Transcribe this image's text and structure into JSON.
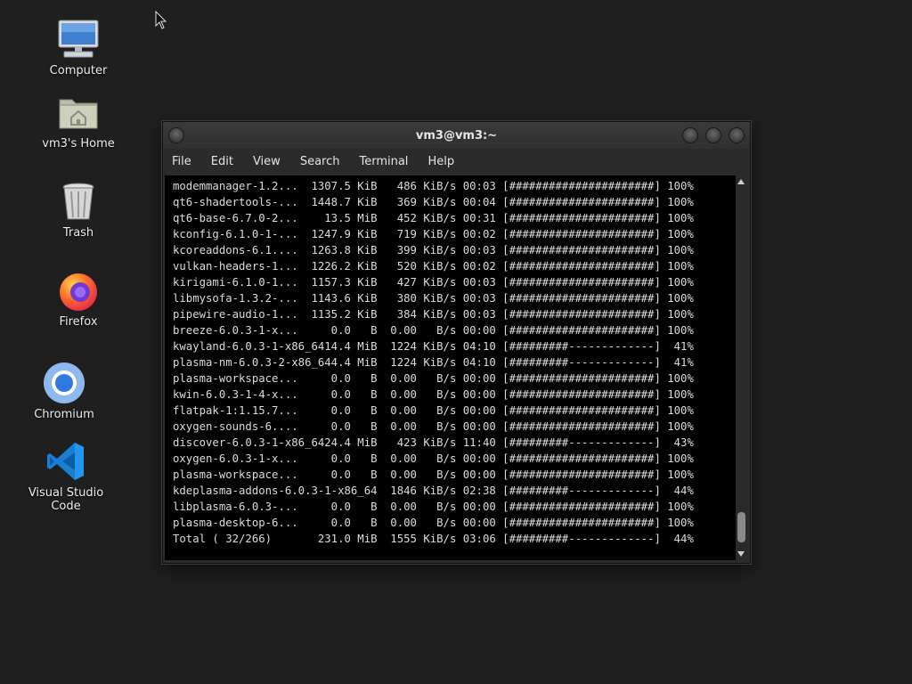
{
  "desktop": {
    "icons": [
      {
        "label": "Computer",
        "icon": "computer-icon"
      },
      {
        "label": "vm3's Home",
        "icon": "home-folder-icon"
      },
      {
        "label": "Trash",
        "icon": "trash-icon"
      },
      {
        "label": "Firefox",
        "icon": "firefox-icon"
      },
      {
        "label": "Chromium",
        "icon": "chromium-icon"
      },
      {
        "label": "Visual Studio Code",
        "icon": "vscode-icon"
      }
    ]
  },
  "window": {
    "title": "vm3@vm3:~",
    "menu": [
      "File",
      "Edit",
      "View",
      "Search",
      "Terminal",
      "Help"
    ]
  },
  "terminal": {
    "lines": [
      "modemmanager-1.2...  1307.5 KiB   486 KiB/s 00:03 [######################] 100%",
      "qt6-shadertools-...  1448.7 KiB   369 KiB/s 00:04 [######################] 100%",
      "qt6-base-6.7.0-2...    13.5 MiB   452 KiB/s 00:31 [######################] 100%",
      "kconfig-6.1.0-1-...  1247.9 KiB   719 KiB/s 00:02 [######################] 100%",
      "kcoreaddons-6.1....  1263.8 KiB   399 KiB/s 00:03 [######################] 100%",
      "vulkan-headers-1...  1226.2 KiB   520 KiB/s 00:02 [######################] 100%",
      "kirigami-6.1.0-1...  1157.3 KiB   427 KiB/s 00:03 [######################] 100%",
      "libmysofa-1.3.2-...  1143.6 KiB   380 KiB/s 00:03 [######################] 100%",
      "pipewire-audio-1...  1135.2 KiB   384 KiB/s 00:03 [######################] 100%",
      "breeze-6.0.3-1-x...     0.0   B  0.00   B/s 00:00 [######################] 100%",
      "kwayland-6.0.3-1-x86_6414.4 MiB  1224 KiB/s 04:10 [#########-------------]  41%",
      "plasma-nm-6.0.3-2-x86_644.4 MiB  1224 KiB/s 04:10 [#########-------------]  41%",
      "plasma-workspace...     0.0   B  0.00   B/s 00:00 [######################] 100%",
      "kwin-6.0.3-1-4-x...     0.0   B  0.00   B/s 00:00 [######################] 100%",
      "flatpak-1:1.15.7...     0.0   B  0.00   B/s 00:00 [######################] 100%",
      "oxygen-sounds-6....     0.0   B  0.00   B/s 00:00 [######################] 100%",
      "discover-6.0.3-1-x86_6424.4 MiB   423 KiB/s 11:40 [#########-------------]  43%",
      "oxygen-6.0.3-1-x...     0.0   B  0.00   B/s 00:00 [######################] 100%",
      "plasma-workspace...     0.0   B  0.00   B/s 00:00 [######################] 100%",
      "kdeplasma-addons-6.0.3-1-x86_64  1846 KiB/s 02:38 [#########-------------]  44%",
      "libplasma-6.0.3-...     0.0   B  0.00   B/s 00:00 [######################] 100%",
      "plasma-desktop-6...     0.0   B  0.00   B/s 00:00 [######################] 100%",
      "Total ( 32/266)       231.0 MiB  1555 KiB/s 03:06 [#########-------------]  44%"
    ]
  }
}
